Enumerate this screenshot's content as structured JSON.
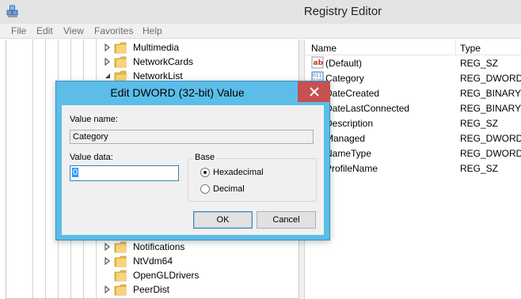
{
  "window": {
    "title": "Registry Editor"
  },
  "menu": [
    "File",
    "Edit",
    "View",
    "Favorites",
    "Help"
  ],
  "tree": {
    "items": [
      {
        "label": "Multimedia",
        "expander": "collapsed"
      },
      {
        "label": "NetworkCards",
        "expander": "collapsed"
      },
      {
        "label": "NetworkList",
        "expander": "expanded"
      },
      {
        "label": "Notifications",
        "expander": "collapsed"
      },
      {
        "label": "NtVdm64",
        "expander": "collapsed"
      },
      {
        "label": "OpenGLDrivers",
        "expander": "none"
      },
      {
        "label": "PeerDist",
        "expander": "collapsed"
      }
    ]
  },
  "list": {
    "headers": {
      "name": "Name",
      "type": "Type"
    },
    "rows": [
      {
        "icon": "string-value-icon",
        "name": "(Default)",
        "type": "REG_SZ"
      },
      {
        "icon": "binary-value-icon",
        "name": "Category",
        "type": "REG_DWORD"
      },
      {
        "icon": "binary-value-icon",
        "name": "DateCreated",
        "type": "REG_BINARY"
      },
      {
        "icon": "binary-value-icon",
        "name": "DateLastConnected",
        "type": "REG_BINARY"
      },
      {
        "icon": "string-value-icon",
        "name": "Description",
        "type": "REG_SZ"
      },
      {
        "icon": "binary-value-icon",
        "name": "Managed",
        "type": "REG_DWORD"
      },
      {
        "icon": "binary-value-icon",
        "name": "NameType",
        "type": "REG_DWORD"
      },
      {
        "icon": "string-value-icon",
        "name": "ProfileName",
        "type": "REG_SZ"
      }
    ]
  },
  "dialog": {
    "title": "Edit DWORD (32-bit) Value",
    "value_name_label": "Value name:",
    "value_name": "Category",
    "value_data_label": "Value data:",
    "value_data": "0",
    "base_label": "Base",
    "base_options": [
      {
        "label": "Hexadecimal",
        "checked": true
      },
      {
        "label": "Decimal",
        "checked": false
      }
    ],
    "ok_label": "OK",
    "cancel_label": "Cancel"
  },
  "colors": {
    "dialog_frame": "#5cbde9",
    "close_button": "#c75050",
    "selection": "#3399ff"
  }
}
